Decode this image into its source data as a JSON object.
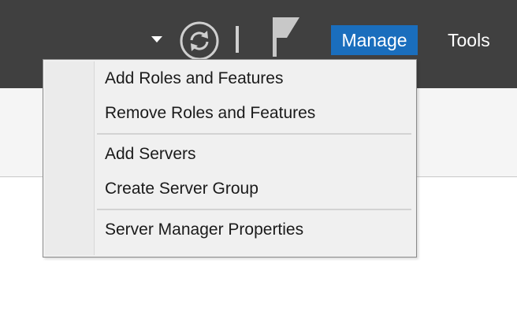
{
  "header": {
    "dropdown_icon": "chevron-down-icon",
    "refresh_icon": "refresh-icon",
    "notifications_icon": "flag-icon",
    "menus": [
      {
        "label": "Manage",
        "active": true
      },
      {
        "label": "Tools",
        "active": false
      }
    ],
    "colors": {
      "bar": "#404040",
      "active_menu": "#1a6ebd"
    }
  },
  "manage_menu": {
    "groups": [
      {
        "items": [
          "Add Roles and Features",
          "Remove Roles and Features"
        ]
      },
      {
        "items": [
          "Add Servers",
          "Create Server Group"
        ]
      },
      {
        "items": [
          "Server Manager Properties"
        ]
      }
    ]
  }
}
